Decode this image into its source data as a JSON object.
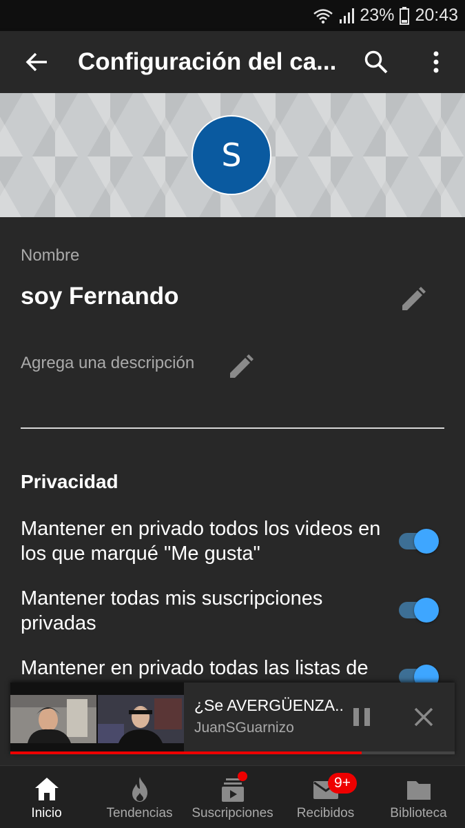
{
  "status_bar": {
    "battery": "23%",
    "time": "20:43"
  },
  "app_bar": {
    "title": "Configuración del ca..."
  },
  "channel": {
    "avatar_letter": "S",
    "name_label": "Nombre",
    "name": "soy Fernando",
    "description_placeholder": "Agrega una descripción"
  },
  "privacy": {
    "title": "Privacidad",
    "options": [
      {
        "label": "Mantener en privado todos los videos en los que marqué \"Me gusta\"",
        "enabled": true
      },
      {
        "label": "Mantener todas mis suscripciones privadas",
        "enabled": true
      },
      {
        "label": "Mantener en privado todas las listas de",
        "enabled": true
      }
    ]
  },
  "mini_player": {
    "title": "¿Se AVERGÜENZA..",
    "channel": "JuanSGuarnizo",
    "progress": 0.79
  },
  "bottom_nav": {
    "tabs": [
      {
        "label": "Inicio",
        "icon": "home-icon",
        "active": true
      },
      {
        "label": "Tendencias",
        "icon": "fire-icon"
      },
      {
        "label": "Suscripciones",
        "icon": "subscriptions-icon"
      },
      {
        "label": "Recibidos",
        "icon": "mail-icon",
        "badge": "9+"
      },
      {
        "label": "Biblioteca",
        "icon": "folder-icon"
      }
    ]
  },
  "colors": {
    "accent": "#3ea6ff",
    "red": "#e00000",
    "background": "#282828"
  }
}
